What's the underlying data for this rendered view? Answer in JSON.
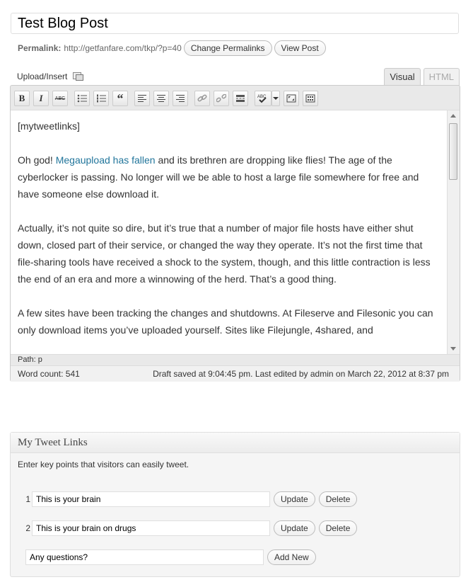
{
  "post": {
    "title": "Test Blog Post",
    "permalink_label": "Permalink:",
    "permalink_url": "http://getfanfare.com/tkp/?p=40",
    "change_permalinks": "Change Permalinks",
    "view_post": "View Post"
  },
  "editor": {
    "upload_insert": "Upload/Insert",
    "tabs": {
      "visual": "Visual",
      "html": "HTML"
    },
    "toolbar": {
      "bold": "B",
      "italic": "I",
      "strike": "ABC"
    },
    "content": {
      "shortcode": "[mytweetlinks]",
      "p1_before": "Oh god! ",
      "p1_link": "Megaupload has fallen",
      "p1_after": " and its brethren are dropping like flies! The age of the cyberlocker is passing. No longer will we be able to host a large file somewhere for free and have someone else download it.",
      "p2": "Actually, it’s not quite so dire, but it’s true that a number of major file hosts have either shut down, closed part of their service, or changed the way they operate. It’s not the first time that file-sharing tools have received a shock to the system, though, and this little contraction is less the end of an era and more a winnowing of the herd. That’s a good thing.",
      "p3": "A few sites have been tracking the changes and shutdowns. At Fileserve and Filesonic you can only download items you’ve uploaded yourself. Sites like Filejungle, 4shared, and"
    },
    "path_label": "Path: ",
    "path_value": "p",
    "word_count": "Word count: 541",
    "draft_status": "Draft saved at 9:04:45 pm. Last edited by admin on March 22, 2012 at 8:37 pm"
  },
  "tweet_links": {
    "heading": "My Tweet Links",
    "description": "Enter key points that visitors can easily tweet.",
    "items": [
      {
        "num": "1",
        "value": "This is your brain"
      },
      {
        "num": "2",
        "value": "This is your brain on drugs"
      }
    ],
    "update_label": "Update",
    "delete_label": "Delete",
    "new_value": "Any questions?",
    "add_new_label": "Add New"
  }
}
